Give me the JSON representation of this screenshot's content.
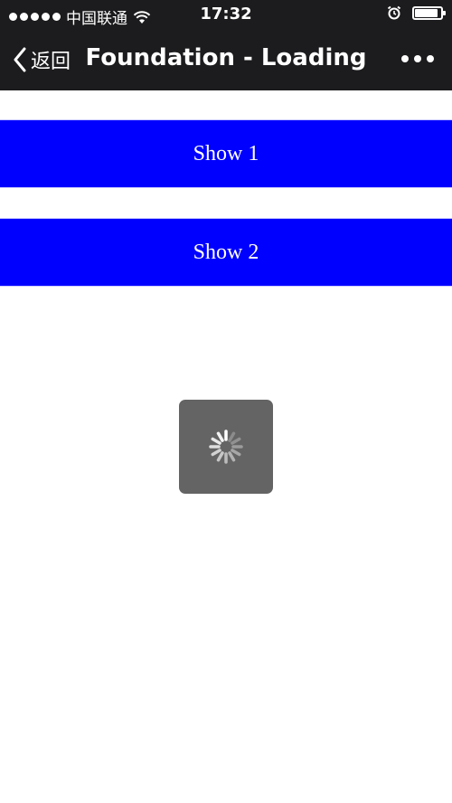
{
  "status_bar": {
    "carrier": "中国联通",
    "time": "17:32",
    "signal_icon": "signal-dots-icon",
    "wifi_icon": "wifi-icon",
    "alarm_icon": "alarm-clock-icon",
    "battery_icon": "battery-icon",
    "battery_level": 0.9
  },
  "nav": {
    "back_label": "返回",
    "back_icon": "chevron-left-icon",
    "title": "Foundation - Loading",
    "more_icon": "more-dots-icon"
  },
  "buttons": [
    {
      "label": "Show 1"
    },
    {
      "label": "Show 2"
    }
  ],
  "loading_toast": {
    "spinner_icon": "loading-spinner-icon"
  },
  "colors": {
    "button_bg": "#0000ff",
    "nav_bg": "#1c1c1e",
    "toast_bg": "#646464"
  }
}
